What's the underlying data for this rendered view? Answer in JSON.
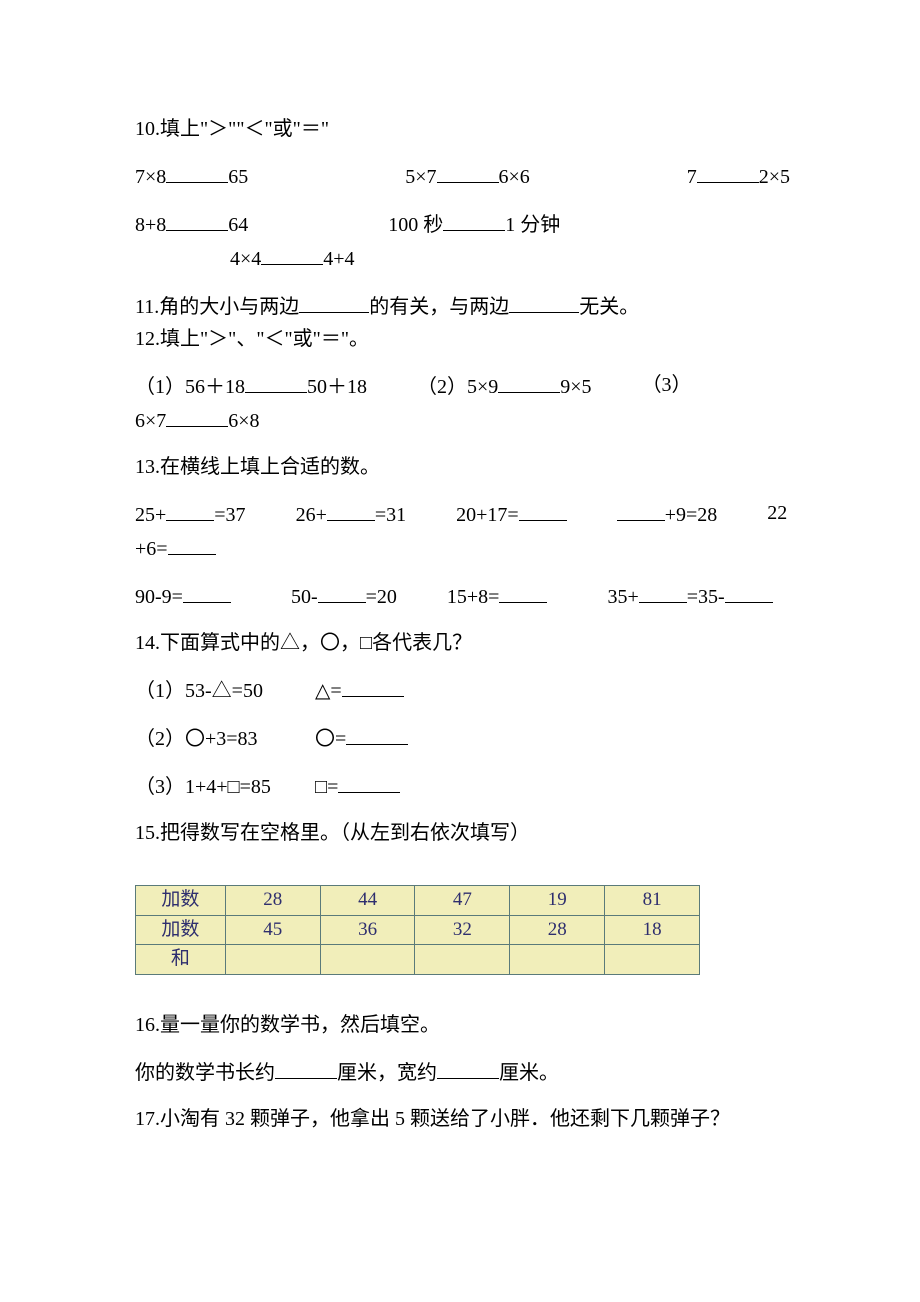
{
  "q10": {
    "title": "10.填上\"＞\"\"＜\"或\"＝\"",
    "r1a": "7×8",
    "r1a_after": "65",
    "r1b": "5×7",
    "r1b_after": "6×6",
    "r1c": "7",
    "r1c_after": "2×5",
    "r2a": "8+8",
    "r2a_after": "64",
    "r2b": "100 秒",
    "r2b_after": "1 分钟",
    "r3a": "4×4",
    "r3a_after": "4+4"
  },
  "q11": {
    "pre": "11.角的大小与两边",
    "mid": "的有关，与两边",
    "post": "无关。"
  },
  "q12": {
    "title": "12.填上\"＞\"、\"＜\"或\"＝\"。",
    "a_pre": "（1）56＋18",
    "a_post": "50＋18",
    "b_pre": "（2）5×9",
    "b_post": "9×5",
    "c_label": "（3）",
    "c_pre": "6×7",
    "c_post": "6×8"
  },
  "q13": {
    "title": "13.在横线上填上合适的数。",
    "r1": {
      "a": "25+",
      "a2": "=37",
      "b": "26+",
      "b2": "=31",
      "c": "20+17=",
      "d2": "+9=28",
      "e": "22",
      "e2": "+6="
    },
    "r2": {
      "a": "90-9=",
      "b": "50-",
      "b2": "=20",
      "c": "15+8=",
      "d": "35+",
      "d2": "=35-"
    }
  },
  "q14": {
    "title": "14.下面算式中的△，〇，□各代表几？",
    "l1a": "（1）53-△=50",
    "l1b": "△=",
    "l2a": "（2）〇+3=83",
    "l2b": "〇=",
    "l3a": "（3）1+4+□=85",
    "l3b": "□="
  },
  "q15": {
    "title": "15.把得数写在空格里。（从左到右依次填写）",
    "header": "加数",
    "sum": "和",
    "row1": [
      "28",
      "44",
      "47",
      "19",
      "81"
    ],
    "row2": [
      "45",
      "36",
      "32",
      "28",
      "18"
    ]
  },
  "q16": {
    "title": "16.量一量你的数学书，然后填空。",
    "line_pre": "你的数学书长约",
    "line_mid": "厘米，宽约",
    "line_post": "厘米。"
  },
  "q17": {
    "text": "17.小淘有 32 颗弹子，他拿出 5 颗送给了小胖．他还剩下几颗弹子？"
  },
  "chart_data": {
    "type": "table",
    "title": "加法表",
    "columns": [
      "加数",
      "c1",
      "c2",
      "c3",
      "c4",
      "c5"
    ],
    "rows": [
      {
        "label": "加数",
        "values": [
          28,
          44,
          47,
          19,
          81
        ]
      },
      {
        "label": "加数",
        "values": [
          45,
          36,
          32,
          28,
          18
        ]
      },
      {
        "label": "和",
        "values": [
          null,
          null,
          null,
          null,
          null
        ]
      }
    ]
  }
}
